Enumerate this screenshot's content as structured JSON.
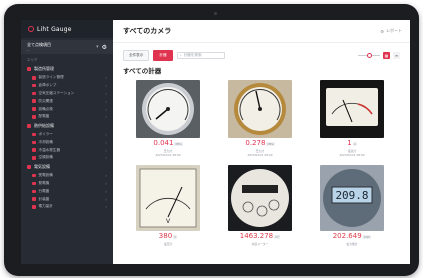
{
  "app": {
    "brand": "Liht Gauge"
  },
  "sidebar": {
    "workspace_title": "全て点検項目",
    "workspace_sub": "---",
    "section_label": "エリア",
    "groups": [
      {
        "label": "製造所管理",
        "items": [
          "製造ライン管理",
          "倉庫ポンプ",
          "空気圧縮ステーション",
          "防災関連",
          "設備点検",
          "配電盤"
        ]
      },
      {
        "label": "熱供給設備",
        "items": [
          "ボイラー",
          "冷却設備",
          "冷温水発生器",
          "空調設備"
        ]
      },
      {
        "label": "電気設備",
        "items": [
          "受電設備",
          "発電機",
          "分電盤",
          "計装盤",
          "電力量計"
        ]
      }
    ]
  },
  "main": {
    "page_title": "すべてのカメラ",
    "report_label": "レポート",
    "tabs": [
      "全件表示",
      "計器"
    ],
    "search_placeholder": "計器を検索",
    "section_title": "すべての計器"
  },
  "cards": [
    {
      "value": "0.041",
      "unit": "MPa",
      "meta": "圧力計",
      "meta2": "2023/02/21 08:00"
    },
    {
      "value": "0.278",
      "unit": "MPa",
      "meta": "圧力計",
      "meta2": "2023/02/21 08:00"
    },
    {
      "value": "1",
      "unit": "A",
      "meta": "電流計",
      "meta2": "2023/02/21 08:00"
    },
    {
      "value": "380",
      "unit": "V",
      "meta": "電圧計",
      "meta2": ""
    },
    {
      "value": "1463.278",
      "unit": "m³",
      "meta": "水道メーター",
      "meta2": ""
    },
    {
      "value": "202.649",
      "unit": "kWh",
      "meta": "電力量計",
      "meta2": ""
    }
  ],
  "colors": {
    "accent": "#e0334f",
    "sidebar": "#272b33"
  }
}
